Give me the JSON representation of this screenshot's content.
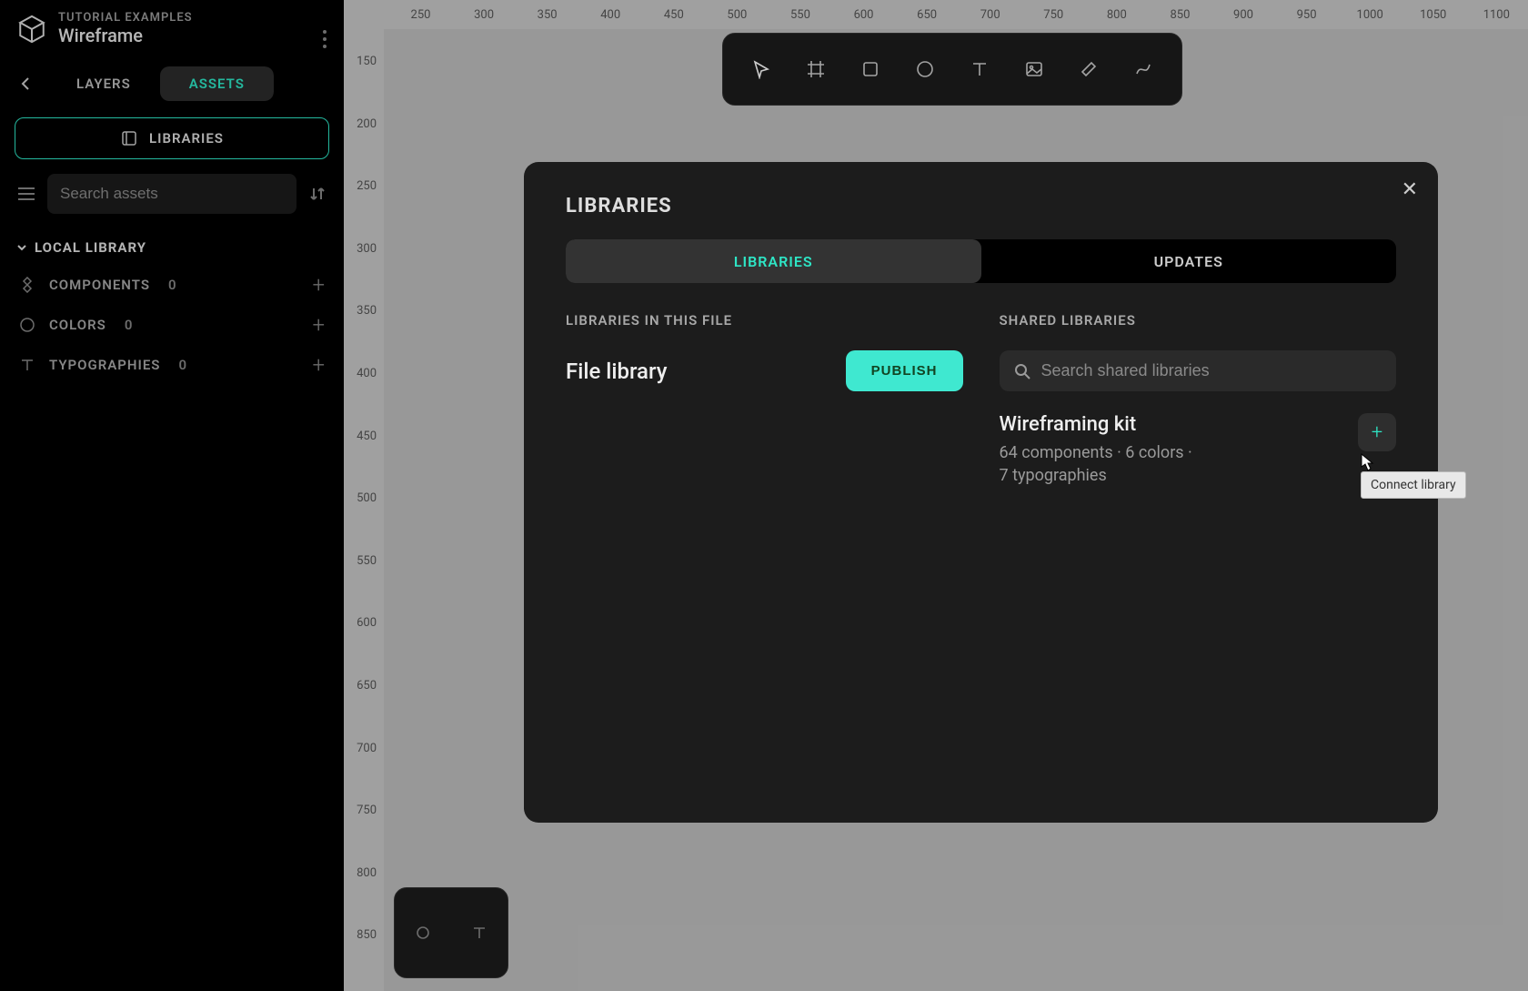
{
  "project": {
    "breadcrumb": "TUTORIAL EXAMPLES",
    "name": "Wireframe"
  },
  "sidebar": {
    "tabs": {
      "layers": "LAYERS",
      "assets": "ASSETS"
    },
    "libraries_button": "LIBRARIES",
    "search_placeholder": "Search assets",
    "section": "LOCAL LIBRARY",
    "items": [
      {
        "label": "COMPONENTS",
        "count": "0"
      },
      {
        "label": "COLORS",
        "count": "0"
      },
      {
        "label": "TYPOGRAPHIES",
        "count": "0"
      }
    ]
  },
  "ruler": {
    "top": [
      "250",
      "300",
      "350",
      "400",
      "450",
      "500",
      "550",
      "600",
      "650",
      "700",
      "750",
      "800",
      "850",
      "900",
      "950",
      "1000",
      "1050",
      "1100"
    ],
    "left": [
      "150",
      "200",
      "250",
      "300",
      "350",
      "400",
      "450",
      "500",
      "550",
      "600",
      "650",
      "700",
      "750",
      "800",
      "850"
    ]
  },
  "modal": {
    "title": "LIBRARIES",
    "tabs": {
      "libraries": "LIBRARIES",
      "updates": "UPDATES"
    },
    "left": {
      "heading": "LIBRARIES IN THIS FILE",
      "file_library_name": "File library",
      "publish": "PUBLISH"
    },
    "right": {
      "heading": "SHARED LIBRARIES",
      "search_placeholder": "Search shared libraries",
      "item": {
        "name": "Wireframing kit",
        "meta_line1": "64 components · 6 colors ·",
        "meta_line2": "7 typographies"
      }
    }
  },
  "tooltip": "Connect library"
}
